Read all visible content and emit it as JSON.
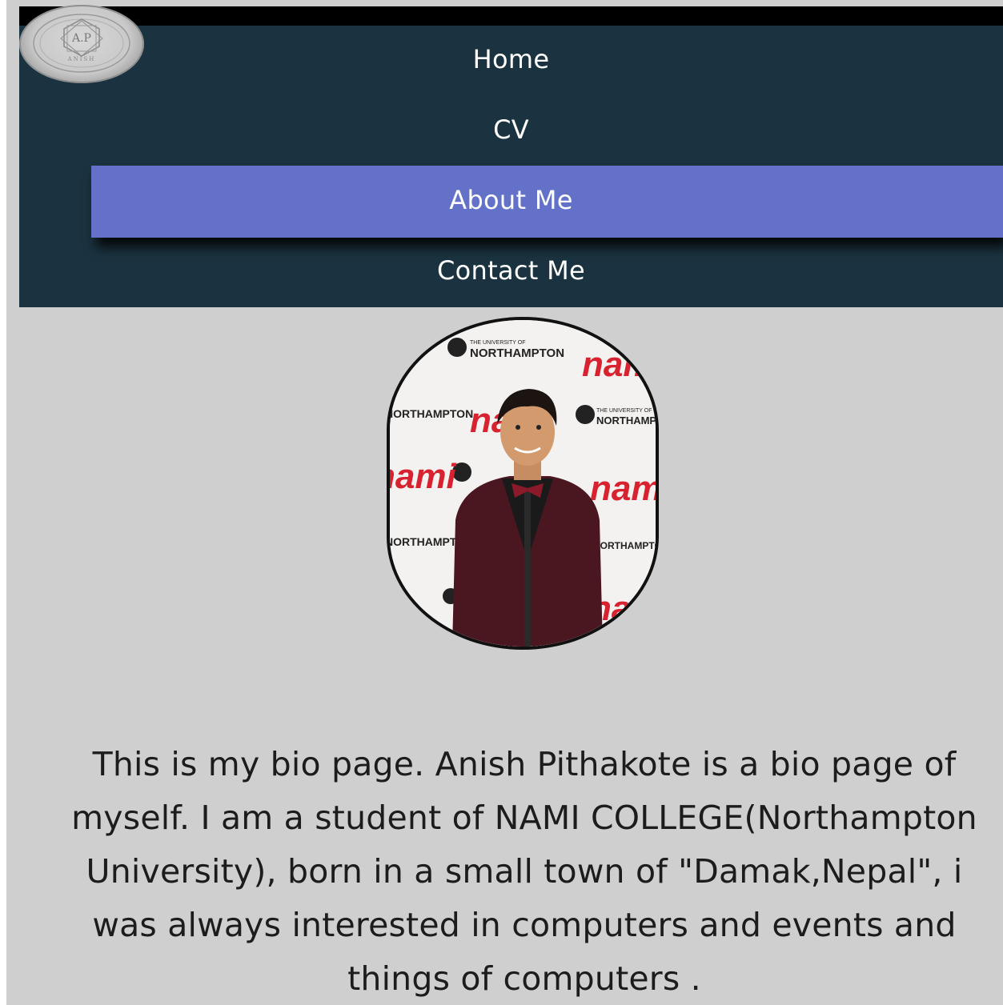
{
  "logo": {
    "initials": "A.P",
    "name": "ANISH"
  },
  "nav": {
    "items": [
      {
        "label": "Home"
      },
      {
        "label": "CV"
      },
      {
        "label": "About Me",
        "active": true
      },
      {
        "label": "Contact Me"
      }
    ]
  },
  "profile": {
    "backdrop_text": [
      "THE UNIVERSITY OF",
      "NORTHAMPTON",
      "nami"
    ]
  },
  "bio": {
    "text": "This is my bio page. Anish Pithakote is a bio page of myself. I am a student of NAMI COLLEGE(Northampton University), born in a small town of \"Damak,Nepal\", i was always interested in computers and events and things of computers ."
  },
  "colors": {
    "nav_bg": "#1b3340",
    "active_bg": "#6372c8",
    "page_bg": "#cfcfcf",
    "nami_red": "#d8222f"
  }
}
